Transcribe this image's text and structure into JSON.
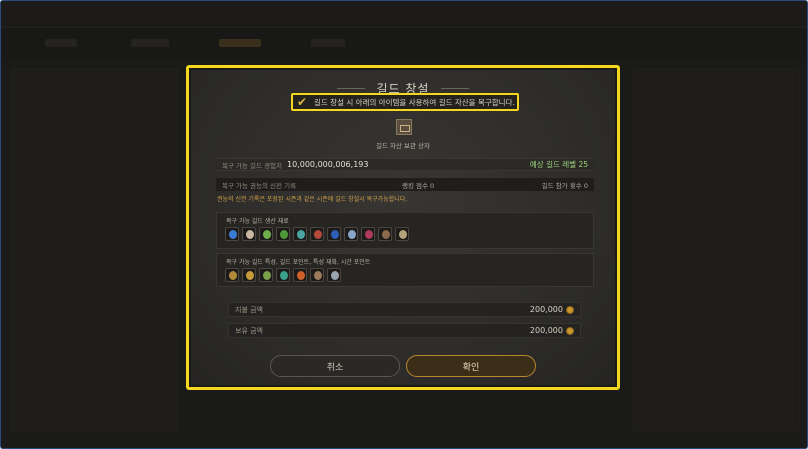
{
  "dialog": {
    "title": "길드 창설",
    "checkbox_label": "길드 창설 시 아래의 아이템을 사용하여 길드 자산을 복구합니다.",
    "checkbox_checked": true,
    "chest_label": "길드 자산 보관 상자",
    "exp_label": "복구 가능 길드 경험치",
    "exp_value": "10,000,000,006,193",
    "expected_level": "예상 길드 레벨 25",
    "records_label": "복구 가능 권능의 신전 기록",
    "ranking_score": "랭킹 점수 0",
    "participation": "길드 참가 횟수 0",
    "note": "권능의 신전 기록은 포장된 시즌과 같은 시즌에 길드 창설시 복구가능합니다.",
    "materials_label": "복구 가능 길드 생산 재료",
    "materials": [
      {
        "name": "blue-crystal-icon",
        "color": "#3a7bd5"
      },
      {
        "name": "mushroom-icon",
        "color": "#c9b7a0"
      },
      {
        "name": "herb-icon",
        "color": "#6fb04a"
      },
      {
        "name": "leaf-icon",
        "color": "#4f9a3a"
      },
      {
        "name": "feather-icon",
        "color": "#49a6a0"
      },
      {
        "name": "flower-icon",
        "color": "#b64a3a"
      },
      {
        "name": "orb-icon",
        "color": "#2c5fb5"
      },
      {
        "name": "ore-icon",
        "color": "#8aa6c8"
      },
      {
        "name": "wand-icon",
        "color": "#b03a5a"
      },
      {
        "name": "gear-core-icon",
        "color": "#8a6a4a"
      },
      {
        "name": "coin-core-icon",
        "color": "#b3a27a"
      }
    ],
    "properties_label": "복구 가능 길드 특성, 길드 포인트, 특성 재화, 시간 포인트",
    "properties": [
      {
        "name": "star-medal-icon",
        "color": "#b08a3a"
      },
      {
        "name": "guild-coin-icon",
        "color": "#c79a3a"
      },
      {
        "name": "green-token-icon",
        "color": "#7aa04a"
      },
      {
        "name": "teal-token-icon",
        "color": "#3aa08a"
      },
      {
        "name": "fire-token-icon",
        "color": "#d0602a"
      },
      {
        "name": "skill-token-icon",
        "color": "#9a7a5a"
      },
      {
        "name": "silver-token-icon",
        "color": "#9aa4b0"
      }
    ],
    "pay_label": "지불 금액",
    "pay_value": "200,000",
    "own_label": "보유 금액",
    "own_value": "200,000",
    "cancel_label": "취소",
    "confirm_label": "확인"
  }
}
